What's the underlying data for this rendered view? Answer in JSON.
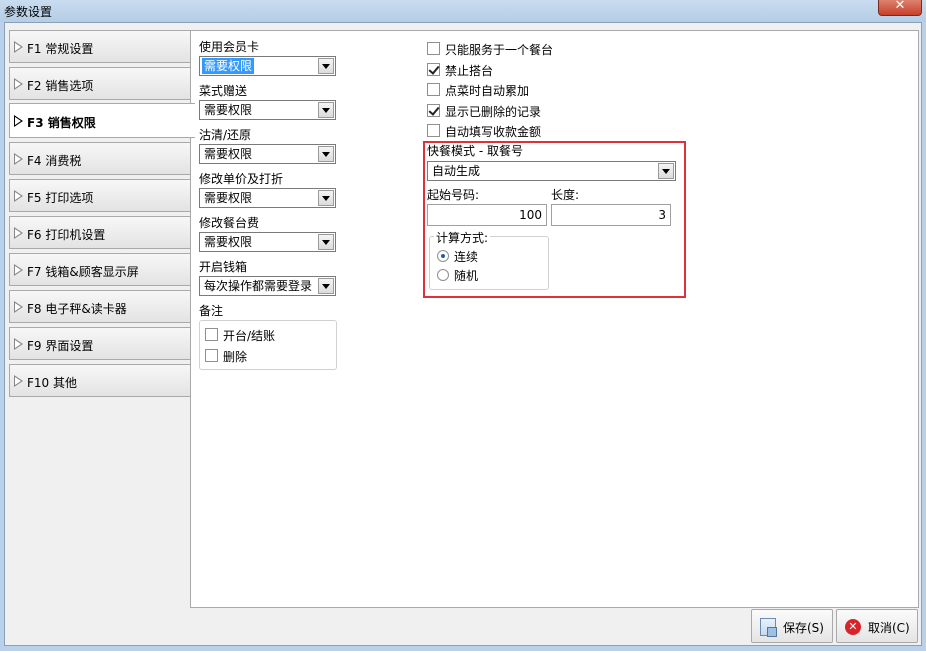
{
  "window": {
    "title": "参数设置",
    "close_glyph": "✕"
  },
  "nav": {
    "items": [
      {
        "label": "F1 常规设置"
      },
      {
        "label": "F2 销售选项"
      },
      {
        "label": "F3 销售权限",
        "active": true
      },
      {
        "label": "F4 消费税"
      },
      {
        "label": "F5 打印选项"
      },
      {
        "label": "F6 打印机设置"
      },
      {
        "label": "F7 钱箱&顾客显示屏"
      },
      {
        "label": "F8 电子秤&读卡器"
      },
      {
        "label": "F9 界面设置"
      },
      {
        "label": "F10 其他"
      }
    ]
  },
  "left_fields": [
    {
      "label": "使用会员卡",
      "value": "需要权限",
      "highlighted": true
    },
    {
      "label": "菜式赠送",
      "value": "需要权限"
    },
    {
      "label": "沽清/还原",
      "value": "需要权限"
    },
    {
      "label": "修改单价及打折",
      "value": "需要权限"
    },
    {
      "label": "修改餐台费",
      "value": "需要权限"
    },
    {
      "label": "开启钱箱",
      "value": "每次操作都需要登录"
    }
  ],
  "remarks": {
    "label": "备注",
    "options": [
      {
        "label": "开台/结账",
        "checked": false
      },
      {
        "label": "删除",
        "checked": false
      }
    ]
  },
  "right_checks": [
    {
      "label": "只能服务于一个餐台",
      "checked": false
    },
    {
      "label": "禁止搭台",
      "checked": true
    },
    {
      "label": "点菜时自动累加",
      "checked": false
    },
    {
      "label": "显示已删除的记录",
      "checked": true
    },
    {
      "label": "自动填写收款金额",
      "checked": false
    }
  ],
  "fast_food": {
    "title": "快餐模式 - 取餐号",
    "mode_value": "自动生成",
    "start_label": "起始号码:",
    "start_value": "100",
    "length_label": "长度:",
    "length_value": "3",
    "calc_label": "计算方式:",
    "calc_options": [
      {
        "label": "连续",
        "selected": true
      },
      {
        "label": "随机",
        "selected": false
      }
    ]
  },
  "buttons": {
    "save": "保存(S)",
    "cancel": "取消(C)"
  },
  "colors": {
    "highlight_red": "#e0303a",
    "selection_blue": "#3399ff"
  }
}
